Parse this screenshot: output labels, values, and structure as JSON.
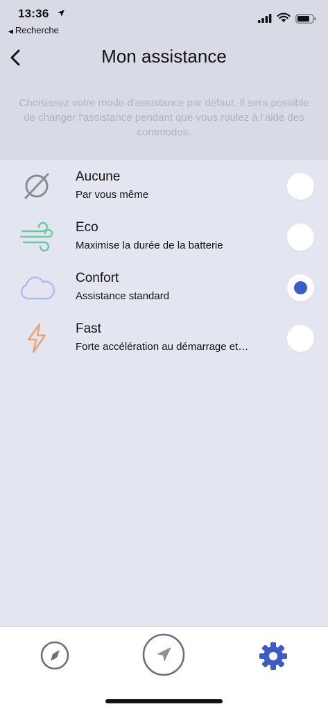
{
  "status_bar": {
    "time": "13:36",
    "back_app_label": "Recherche"
  },
  "header": {
    "title": "Mon assistance",
    "intro": "Choisissez votre mode d'assistance par défaut.  Il sera possible de changer l'assistance pendant  que vous roulez à l'aide des commodos."
  },
  "options": [
    {
      "title": "Aucune",
      "subtitle": "Par vous même",
      "icon": "none-slash-icon",
      "selected": false
    },
    {
      "title": "Eco",
      "subtitle": "Maximise la durée de la batterie",
      "icon": "wind-icon",
      "selected": false
    },
    {
      "title": "Confort",
      "subtitle": "Assistance standard",
      "icon": "cloud-icon",
      "selected": true
    },
    {
      "title": "Fast",
      "subtitle": "Forte accélération au démarrage et…",
      "icon": "lightning-icon",
      "selected": false
    }
  ],
  "tabs": [
    {
      "name": "compass-icon",
      "active": false
    },
    {
      "name": "navigation-arrow-icon",
      "active": false
    },
    {
      "name": "gear-icon",
      "active": true
    }
  ],
  "colors": {
    "accent": "#3d5cc8",
    "background": "#e3e6f0",
    "header_background": "#d8dbe6",
    "eco_icon": "#6fc7a0",
    "confort_icon": "#a9bdf0",
    "fast_icon": "#f0a06a",
    "aucune_icon": "#8a8c94"
  }
}
